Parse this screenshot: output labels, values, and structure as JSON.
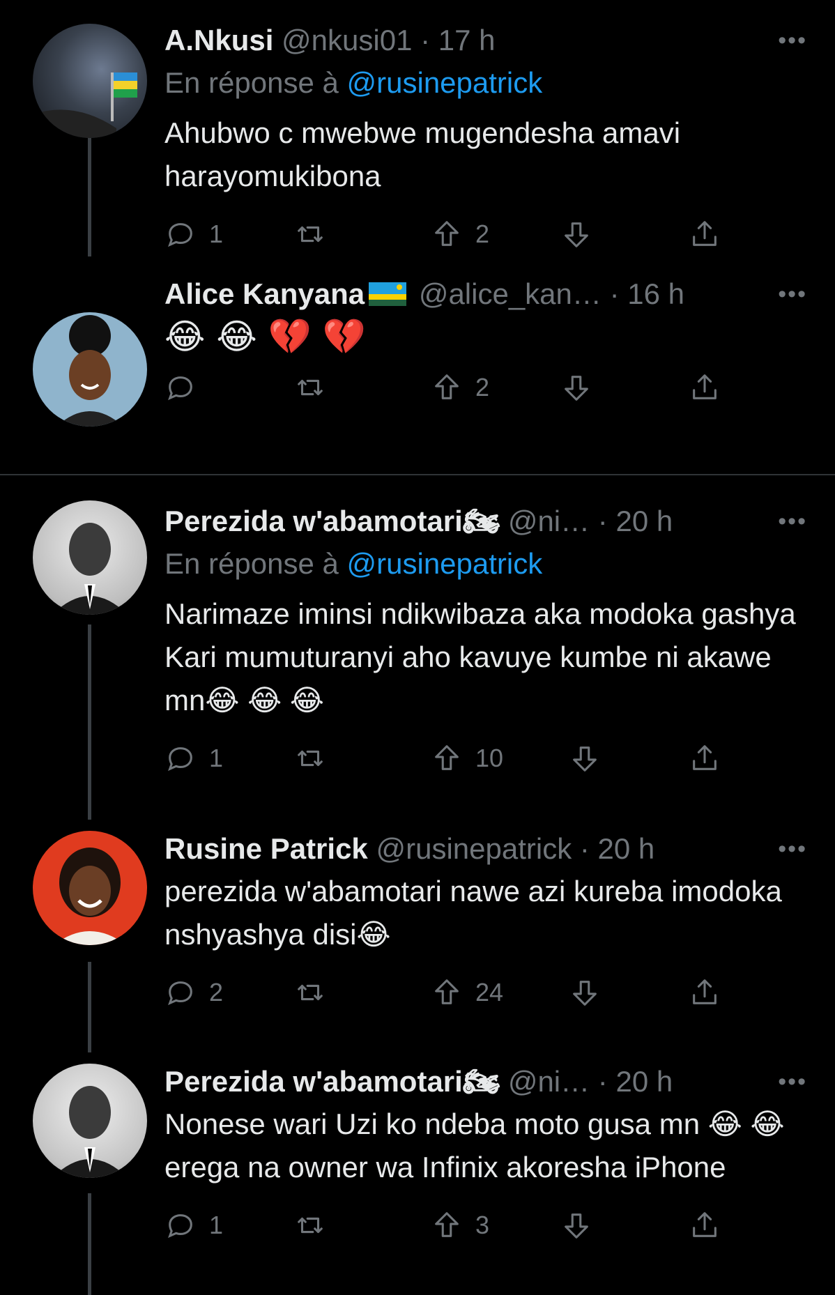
{
  "tweets": [
    {
      "name": "A.Nkusi",
      "handle": "@nkusi01",
      "sep": " · ",
      "time": "17 h",
      "reply_prefix": "En réponse à ",
      "reply_to": "@rusinepatrick",
      "text": "Ahubwo c mwebwe mugendesha amavi harayomukibona",
      "stats": {
        "replies": "1",
        "retweets": "",
        "up": "2"
      }
    },
    {
      "name": "Alice Kanyana",
      "handle": "@alice_kan…",
      "sep": " · ",
      "time": "16 h",
      "text": "😂 😂 💔 💔",
      "stats": {
        "replies": "",
        "retweets": "",
        "up": "2"
      }
    },
    {
      "name": "Perezida w'abamotari🏍",
      "handle": "@ni…",
      "sep": " · ",
      "time": "20 h",
      "reply_prefix": "En réponse à ",
      "reply_to": "@rusinepatrick",
      "text": "Narimaze iminsi ndikwibaza aka modoka gashya Kari mumuturanyi aho kavuye kumbe ni akawe mn😂 😂 😂",
      "stats": {
        "replies": "1",
        "retweets": "",
        "up": "10"
      }
    },
    {
      "name": "Rusine Patrick",
      "handle": "@rusinepatrick",
      "sep": " · ",
      "time": "20 h",
      "text": "perezida w'abamotari nawe azi kureba imodoka nshyashya disi😂",
      "stats": {
        "replies": "2",
        "retweets": "",
        "up": "24"
      }
    },
    {
      "name": "Perezida w'abamotari🏍",
      "handle": "@ni…",
      "sep": " · ",
      "time": "20 h",
      "text": "Nonese wari Uzi ko ndeba moto gusa mn 😂 😂 erega na owner wa Infinix akoresha iPhone",
      "stats": {
        "replies": "1",
        "retweets": "",
        "up": "3"
      }
    }
  ],
  "icons": {
    "more": "ellipsis-icon",
    "reply": "reply-icon",
    "retweet": "retweet-icon",
    "upvote": "upvote-icon",
    "downvote": "downvote-icon",
    "share": "share-icon"
  },
  "colors": {
    "background": "#000000",
    "text": "#e7e9ea",
    "muted": "#71767b",
    "link": "#1d9bf0",
    "divider": "#2f3336"
  }
}
